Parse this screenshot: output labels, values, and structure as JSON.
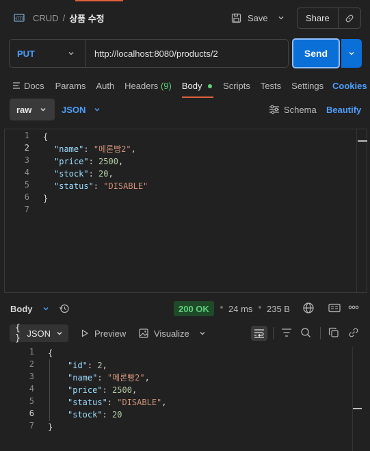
{
  "header": {
    "breadcrumb_parent": "CRUD",
    "breadcrumb_sep": "/",
    "request_name": "상품 수정",
    "save_label": "Save",
    "share_label": "Share"
  },
  "request": {
    "method": "PUT",
    "url": "http://localhost:8080/products/2",
    "send_label": "Send"
  },
  "tabs": {
    "docs": "Docs",
    "params": "Params",
    "auth": "Auth",
    "headers": "Headers",
    "headers_count": "(9)",
    "body": "Body",
    "scripts": "Scripts",
    "tests": "Tests",
    "settings": "Settings",
    "cookies": "Cookies"
  },
  "body_options": {
    "mode": "raw",
    "format": "JSON",
    "schema": "Schema",
    "beautify": "Beautify"
  },
  "request_body": {
    "line_numbers": [
      "1",
      "2",
      "3",
      "4",
      "5",
      "6",
      "7"
    ],
    "open": "{",
    "close": "}",
    "fields": [
      {
        "key": "\"name\"",
        "value": "\"메론빵2\"",
        "type": "string",
        "comma": ","
      },
      {
        "key": "\"price\"",
        "value": "2500",
        "type": "number",
        "comma": ","
      },
      {
        "key": "\"stock\"",
        "value": "20",
        "type": "number",
        "comma": ","
      },
      {
        "key": "\"status\"",
        "value": "\"DISABLE\"",
        "type": "string",
        "comma": ""
      }
    ]
  },
  "response": {
    "label": "Body",
    "status": "200 OK",
    "time": "24 ms",
    "size": "235 B",
    "format": "JSON",
    "preview": "Preview",
    "visualize": "Visualize",
    "line_numbers": [
      "1",
      "2",
      "3",
      "4",
      "5",
      "6",
      "7"
    ],
    "open": "{",
    "close": "}",
    "fields": [
      {
        "key": "\"id\"",
        "value": "2",
        "type": "number",
        "comma": ","
      },
      {
        "key": "\"name\"",
        "value": "\"메론빵2\"",
        "type": "string",
        "comma": ","
      },
      {
        "key": "\"price\"",
        "value": "2500",
        "type": "number",
        "comma": ","
      },
      {
        "key": "\"status\"",
        "value": "\"DISABLE\"",
        "type": "string",
        "comma": ","
      },
      {
        "key": "\"stock\"",
        "value": "20",
        "type": "number",
        "comma": ""
      }
    ]
  },
  "colors": {
    "accent_blue": "#0b6fd8",
    "link_blue": "#4d9fff",
    "status_green_bg": "#1f4a2a",
    "status_green_text": "#5fd17a",
    "tab_underline": "#e0603a"
  }
}
